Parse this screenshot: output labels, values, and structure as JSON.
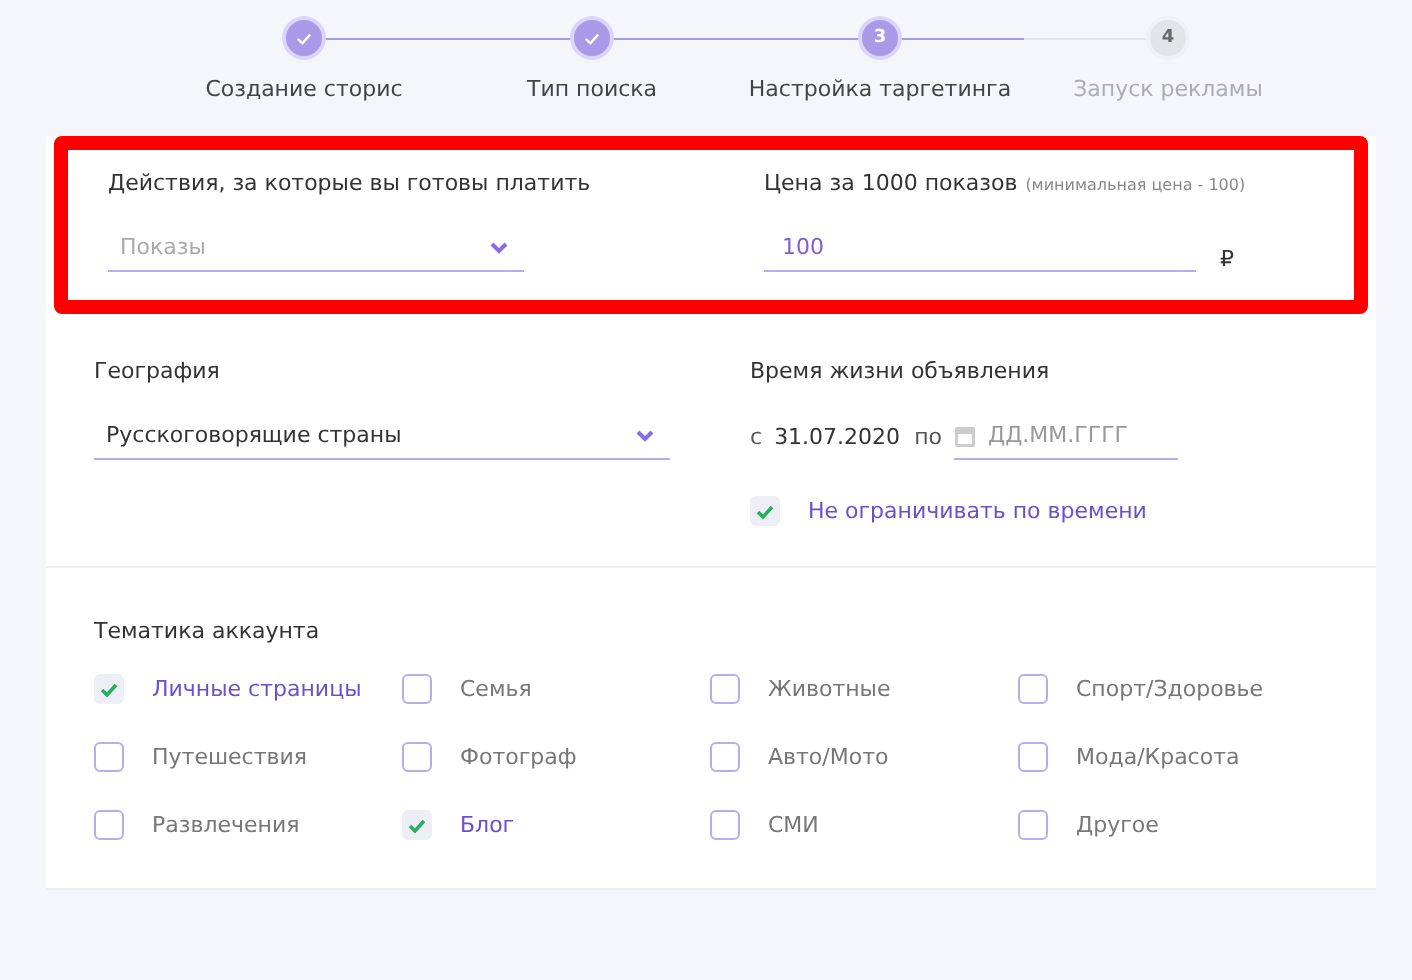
{
  "steps": [
    {
      "label": "Создание сторис",
      "completed": true,
      "active": false
    },
    {
      "label": "Тип поиска",
      "completed": true,
      "active": false
    },
    {
      "label": "Настройка таргетинга",
      "completed": false,
      "active": true,
      "number": "3"
    },
    {
      "label": "Запуск рекламы",
      "completed": false,
      "active": false,
      "number": "4"
    }
  ],
  "pricing": {
    "highlighted": true,
    "action": {
      "label": "Действия, за которые вы готовы платить",
      "placeholder": "Показы"
    },
    "price": {
      "label": "Цена за 1000 показов",
      "hint": "(минимальная цена - 100)",
      "value": "100",
      "currency": "₽"
    }
  },
  "geography": {
    "label": "География",
    "value": "Русскоговорящие страны"
  },
  "lifetime": {
    "label": "Время жизни объявления",
    "from_label": "с",
    "from_value": "31.07.2020",
    "to_label": "по",
    "to_placeholder": "ДД.ММ.ГГГГ",
    "unlimited": {
      "label": "Не ограничивать по времени",
      "checked": true
    }
  },
  "topics": {
    "label": "Тематика аккаунта",
    "items": [
      {
        "label": "Личные страницы",
        "checked": true
      },
      {
        "label": "Семья",
        "checked": false
      },
      {
        "label": "Животные",
        "checked": false
      },
      {
        "label": "Спорт/Здоровье",
        "checked": false
      },
      {
        "label": "Путешествия",
        "checked": false
      },
      {
        "label": "Фотограф",
        "checked": false
      },
      {
        "label": "Авто/Мото",
        "checked": false
      },
      {
        "label": "Мода/Красота",
        "checked": false
      },
      {
        "label": "Развлечения",
        "checked": false
      },
      {
        "label": "Блог",
        "checked": true
      },
      {
        "label": "СМИ",
        "checked": false
      },
      {
        "label": "Другое",
        "checked": false
      }
    ]
  }
}
